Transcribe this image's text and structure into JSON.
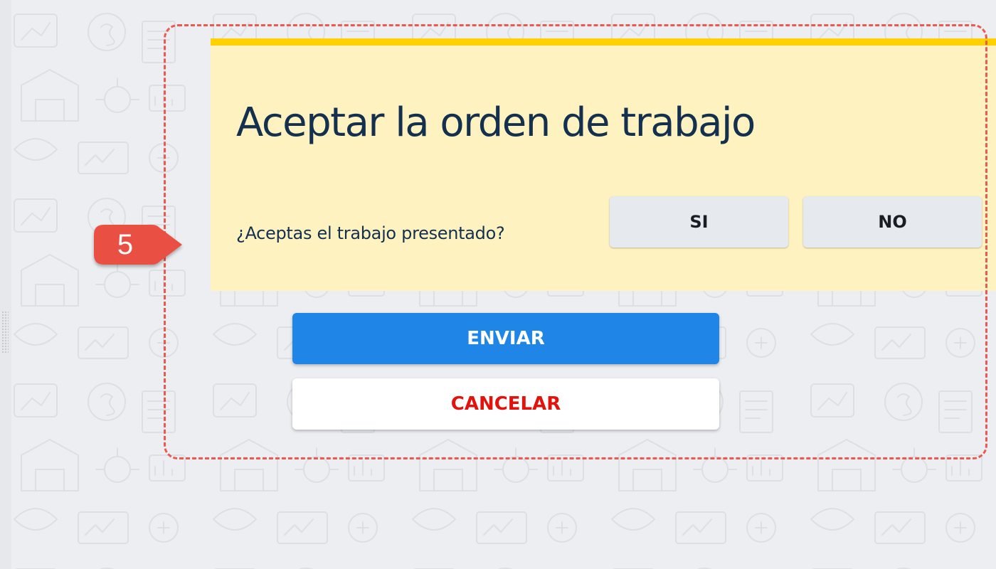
{
  "card": {
    "title": "Aceptar la orden de trabajo",
    "question": "¿Aceptas el trabajo presentado?",
    "options": [
      {
        "label": "SI"
      },
      {
        "label": "NO"
      }
    ]
  },
  "actions": {
    "submit_label": "ENVIAR",
    "cancel_label": "CANCELAR"
  },
  "step_badge": {
    "number": "5"
  },
  "colors": {
    "card_background": "#fef2c0",
    "card_accent": "#ffd100",
    "title_text": "#14304f",
    "submit_button": "#1f86e8",
    "cancel_text": "#e3120b",
    "highlight_frame": "#ea5a50",
    "badge": "#e94f43"
  }
}
